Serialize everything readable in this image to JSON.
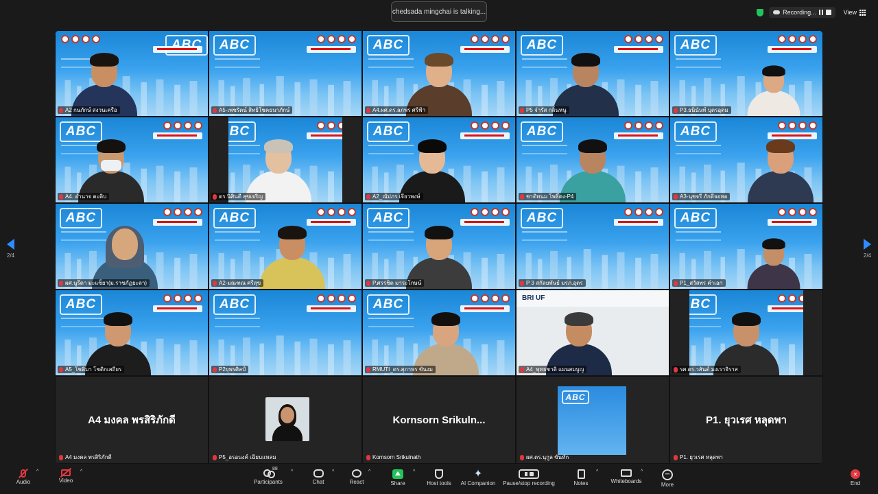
{
  "meeting": {
    "talking_banner": "chedsada mingchai is talking...",
    "recording_label": "Recording...",
    "view_label": "View",
    "page_indicator_left": "2/4",
    "page_indicator_right": "2/4"
  },
  "background": {
    "logo_text": "ABC"
  },
  "participants": [
    {
      "name": "A2 กษภักษ์ สงวนเครือ"
    },
    {
      "name": "A5-เพชรัตน์ สิทธิโชคธนาภักษ์"
    },
    {
      "name": "A4.ผศ.ดร.ลภพร ศรีฟ้า"
    },
    {
      "name": "P5 จำรัส กลิ่นหนู"
    },
    {
      "name": "P3.ธนินันท์ บุตรอุดม"
    },
    {
      "name": "A4. อำนาจ ตะติบ"
    },
    {
      "name": "ดร.นิศินดี สุขเจริญ"
    },
    {
      "name": "A2_ณัปภร เจียวพงษ์"
    },
    {
      "name": "ชาติทนม โพธิ์ดง-P4"
    },
    {
      "name": "A3-นุชจรี ภักดีจอหอ"
    },
    {
      "name": "ผศ.นูรีดา มะแซ็ยา(ม.ราชภัฏยะลา)"
    },
    {
      "name": "A2-มณฑณ ศรีสุข"
    },
    {
      "name": "P.ศรรชิต มาระโกษน์"
    },
    {
      "name": "P 3 สกัลยพันธ์ มรภ.อุดร"
    },
    {
      "name": "P1_สวัสพร คำเอก"
    },
    {
      "name": "A5_โชติมา โชติกเสถียร"
    },
    {
      "name": "P2ยุพรศิลป์"
    },
    {
      "name": "RMUTI_ดร.สุภาพร ขันงม"
    },
    {
      "name": "A4_พุทธชาติ แผนสมบูญ"
    },
    {
      "name": "รศ.ดร.วสันต์ มงเราจิราส"
    }
  ],
  "text_tiles": [
    {
      "display": "A4 มงคล พรสิริภักดี",
      "name": "A4 มงคล พรสิริภักดี"
    },
    {
      "display": "",
      "name": "P5_อรอนงค์ เฉียบแหลม"
    },
    {
      "display": "Kornsorn  Srikuln...",
      "name": "Kornsorn Srikulnath"
    },
    {
      "display": "",
      "name": "ผศ.ดร.นุกูล ขันทัก"
    },
    {
      "display": "P1. ยุวเรศ หลุดพา",
      "name": "P1. ยุวเรศ หลุดพา"
    }
  ],
  "screen_share_label": "BRI UF",
  "toolbar": {
    "audio": "Audio",
    "video": "Video",
    "participants": "Participants",
    "participants_count": "88",
    "chat": "Chat",
    "react": "React",
    "share": "Share",
    "host_tools": "Host tools",
    "ai_companion": "AI Companion",
    "pause_stop_recording": "Pause/stop recording",
    "notes": "Notes",
    "whiteboards": "Whiteboards",
    "more": "More",
    "end": "End"
  },
  "colors": {
    "accent_green": "#23c35b",
    "end_red": "#e0383e",
    "nav_blue": "#2f8cff",
    "tile_blue": "#1a86d6"
  }
}
